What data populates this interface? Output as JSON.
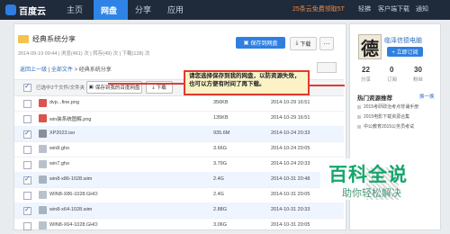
{
  "topnav": {
    "logo": "百度云",
    "items": [
      "主页",
      "网盘",
      "分享",
      "应用"
    ],
    "active": "网盘",
    "promo": "25条云免费领取5T",
    "right": [
      "轻拂",
      "客户端下载",
      "通知"
    ]
  },
  "share": {
    "title": "经典系统分享",
    "meta": "2014-09-19 09:44 | 浏览(461) 次 | 转存(49) 次 | 下载(128) 次",
    "save_btn": "保存到网盘",
    "download_btn": "下载",
    "more_btn": "⋯",
    "breadcrumb": {
      "back": "返回上一级",
      "all": "全部文件",
      "current": "经典系统分享"
    },
    "toolbar": {
      "select_all": "已选中2个文件/文件夹",
      "save_btn": "保存到我的百度网盘",
      "download_btn": "下载"
    },
    "files": [
      {
        "name": "dvp...fine.png",
        "size": "356KB",
        "date": "2014-10-29 16:51",
        "checked": false,
        "type": "image"
      },
      {
        "name": "win装系统图解.png",
        "size": "135KB",
        "date": "2014-10-29 16:51",
        "checked": false,
        "type": "image"
      },
      {
        "name": "XP2023.iso",
        "size": "935.6M",
        "date": "2014-10-24 20:33",
        "checked": true,
        "type": "iso"
      },
      {
        "name": "win8.gho",
        "size": "3.66G",
        "date": "2014-10-24 20:05",
        "checked": false,
        "type": "gho"
      },
      {
        "name": "win7.gho",
        "size": "3.79G",
        "date": "2014-10-24 20:33",
        "checked": false,
        "type": "gho"
      },
      {
        "name": "win8-x86-1028.wim",
        "size": "2.4G",
        "date": "2014-10-31 20:48",
        "checked": true,
        "type": "wim"
      },
      {
        "name": "WIN8-X86-1028.GHO",
        "size": "2.4G",
        "date": "2014-10-31 20:05",
        "checked": false,
        "type": "gho"
      },
      {
        "name": "win8-x64-1028.wim",
        "size": "2.88G",
        "date": "2014-10-31 20:33",
        "checked": true,
        "type": "wim"
      },
      {
        "name": "WIN8-X64-1028.GHO",
        "size": "3.06G",
        "date": "2014-10-31 20:05",
        "checked": false,
        "type": "gho"
      }
    ]
  },
  "callout": "请您选择保存到我的网盘，以防资源失效，也可以方便有时间了再下载。",
  "sidebar": {
    "avatar_char": "德",
    "username": "临泽信德电脑",
    "follow_btn": "+ 立即订阅",
    "stats": [
      {
        "num": "22",
        "label": "分享"
      },
      {
        "num": "0",
        "label": "订阅"
      },
      {
        "num": "30",
        "label": "粉丝"
      }
    ],
    "hot_title": "热门资源推荐",
    "hot_more": "换一换",
    "hot_items": [
      "2015考研政治考点背诵手册",
      "2015电影下载资源合集",
      "中公教育2015公务员考试"
    ]
  },
  "watermark": {
    "main": "百科全说",
    "sub": "助你轻松解决"
  },
  "colors": {
    "accent": "#2f7fe0",
    "nav_bg": "#1f2a3b",
    "callout_border": "#e23a30",
    "watermark": "#14a76c"
  }
}
